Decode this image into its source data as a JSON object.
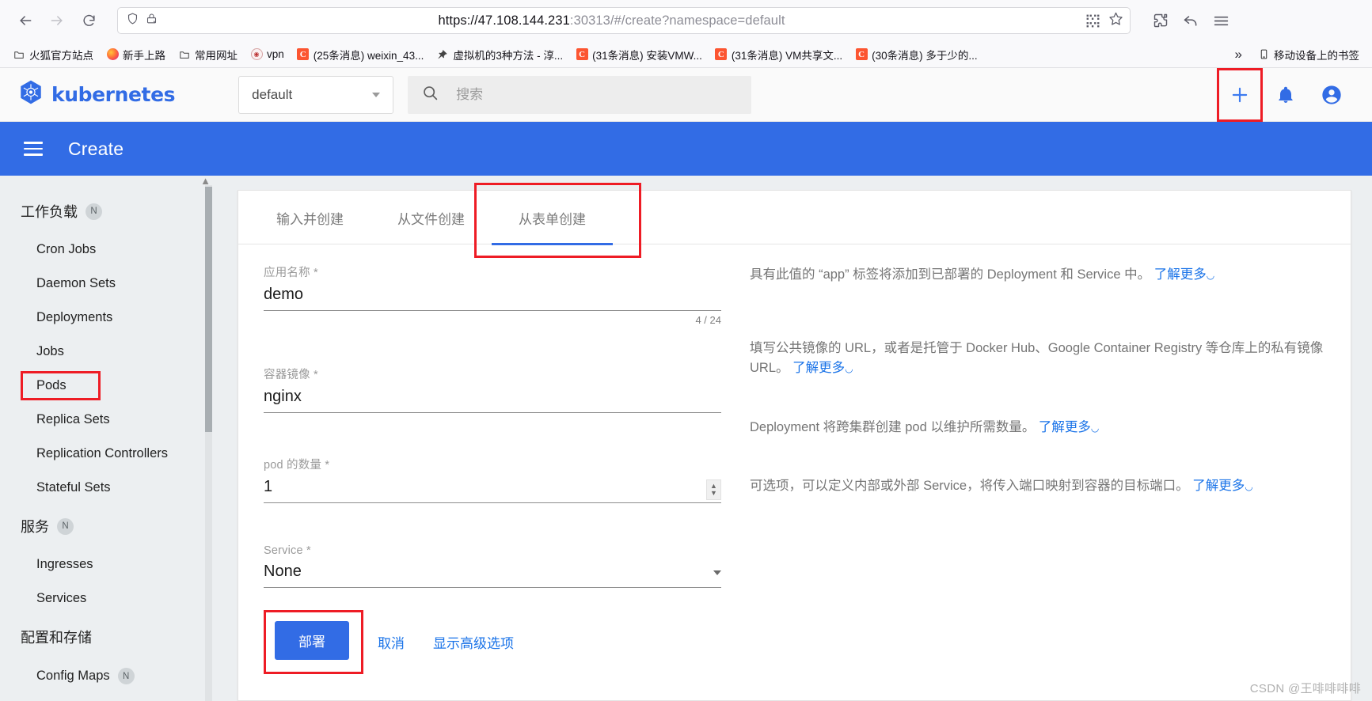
{
  "browser": {
    "back_icon": "back-arrow-icon",
    "forward_icon": "forward-arrow-icon",
    "reload_icon": "reload-icon",
    "shield_icon": "shield-icon",
    "lock_icon": "lock-icon",
    "url_scheme": "https://",
    "url_host": "47.108.144.231",
    "url_port": ":30313",
    "url_path": "/#/create?namespace=default",
    "url_full": "https://47.108.144.231:30313/#/create?namespace=default",
    "qr_icon": "qr-code-icon",
    "star_icon": "bookmark-star-icon",
    "extensions_icon": "extensions-puzzle-icon",
    "undo_icon": "undo-arrow-icon",
    "menu_icon": "hamburger-menu-icon",
    "bookmarks": [
      {
        "label": "火狐官方站点",
        "icon": "folder-icon"
      },
      {
        "label": "新手上路",
        "icon": "firefox-icon"
      },
      {
        "label": "常用网址",
        "icon": "folder-icon"
      },
      {
        "label": "vpn",
        "icon": "vpn-site-icon"
      },
      {
        "label": "(25条消息) weixin_43...",
        "icon": "csdn-icon"
      },
      {
        "label": "虚拟机的3种方法 - 淳...",
        "icon": "pin-icon"
      },
      {
        "label": "(31条消息) 安装VMW...",
        "icon": "csdn-icon"
      },
      {
        "label": "(31条消息) VM共享文...",
        "icon": "csdn-icon"
      },
      {
        "label": "(30条消息) 多于少的...",
        "icon": "csdn-icon"
      }
    ],
    "overflow_label": "»",
    "mobile_bookmarks": "移动设备上的书签",
    "mobile_icon": "mobile-device-icon"
  },
  "topbar": {
    "brand": "kubernetes",
    "logo_icon": "kubernetes-helm-icon",
    "namespace_value": "default",
    "namespace_caret": "chevron-down-icon",
    "search_icon": "search-icon",
    "search_placeholder": "搜索",
    "search_value": "",
    "create_icon": "plus-icon",
    "notifications_icon": "bell-icon",
    "account_icon": "account-circle-icon"
  },
  "header": {
    "menu_icon": "hamburger-menu-icon",
    "title": "Create"
  },
  "sidebar": {
    "groups": [
      {
        "title": "工作负载",
        "badge": "N",
        "items": [
          {
            "label": "Cron Jobs",
            "highlighted": false
          },
          {
            "label": "Daemon Sets",
            "highlighted": false
          },
          {
            "label": "Deployments",
            "highlighted": false
          },
          {
            "label": "Jobs",
            "highlighted": false
          },
          {
            "label": "Pods",
            "highlighted": true
          },
          {
            "label": "Replica Sets",
            "highlighted": false
          },
          {
            "label": "Replication Controllers",
            "highlighted": false
          },
          {
            "label": "Stateful Sets",
            "highlighted": false
          }
        ]
      },
      {
        "title": "服务",
        "badge": "N",
        "items": [
          {
            "label": "Ingresses",
            "highlighted": false
          },
          {
            "label": "Services",
            "highlighted": false
          }
        ]
      },
      {
        "title": "配置和存储",
        "badge": "",
        "items": [
          {
            "label": "Config Maps",
            "badge": "N",
            "highlighted": false
          }
        ]
      }
    ]
  },
  "main": {
    "tabs": [
      {
        "label": "输入并创建",
        "active": false,
        "boxed": false
      },
      {
        "label": "从文件创建",
        "active": false,
        "boxed": false
      },
      {
        "label": "从表单创建",
        "active": true,
        "boxed": true
      }
    ],
    "fields": {
      "app_name": {
        "label": "应用名称 *",
        "value": "demo",
        "counter": "4 / 24"
      },
      "container_image": {
        "label": "容器镜像 *",
        "value": "nginx"
      },
      "pod_count": {
        "label": "pod 的数量 *",
        "value": "1",
        "stepper_icon": "number-stepper-icon"
      },
      "service": {
        "label": "Service *",
        "value": "None",
        "caret_icon": "chevron-down-icon"
      }
    },
    "help": {
      "app_name": {
        "text": "具有此值的 “app” 标签将添加到已部署的 Deployment 和 Service 中。",
        "link": "了解更多",
        "link_icon": "external-link-icon"
      },
      "container_image": {
        "text": "填写公共镜像的 URL，或者是托管于 Docker Hub、Google Container Registry 等仓库上的私有镜像 URL。",
        "link": "了解更多",
        "link_icon": "external-link-icon"
      },
      "pod_count": {
        "text": "Deployment 将跨集群创建 pod 以维护所需数量。",
        "link": "了解更多",
        "link_icon": "external-link-icon"
      },
      "service": {
        "text": "可选项，可以定义内部或外部 Service，将传入端口映射到容器的目标端口。",
        "link": "了解更多",
        "link_icon": "external-link-icon"
      }
    },
    "actions": {
      "deploy": "部署",
      "cancel": "取消",
      "advanced": "显示高级选项"
    }
  },
  "watermark": "CSDN @王啡啡啡啡",
  "colors": {
    "brand_blue": "#326ce5",
    "link_blue": "#1a73e8",
    "highlight_red": "#ee1c25",
    "sidebar_bg": "#eceff1"
  }
}
